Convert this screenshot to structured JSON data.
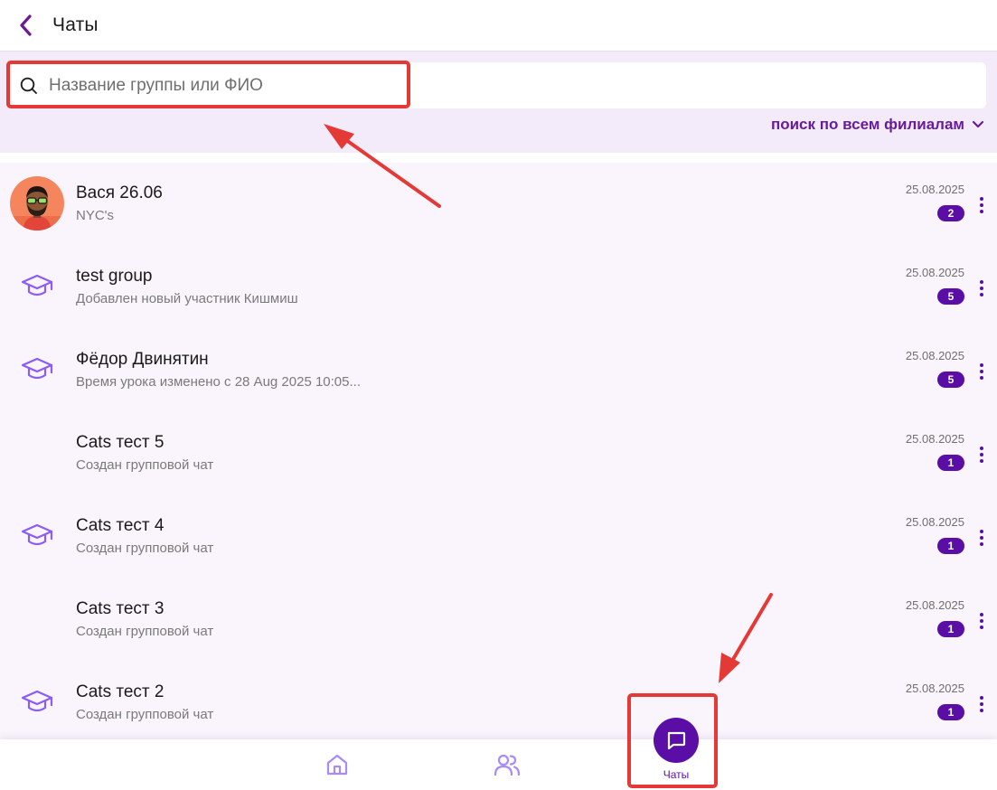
{
  "header": {
    "title": "Чаты"
  },
  "search": {
    "placeholder": "Название группы или ФИО",
    "value": ""
  },
  "branch_filter": {
    "label": "поиск по всем филиалам"
  },
  "chats": [
    {
      "name": "Вася 26.06",
      "preview": "NYC's",
      "date": "25.08.2025",
      "unread": "2",
      "icon": "user-avatar-photo"
    },
    {
      "name": "test group",
      "preview": "Добавлен новый участник Кишмиш",
      "date": "25.08.2025",
      "unread": "5",
      "icon": "graduation-cap-icon"
    },
    {
      "name": "Фёдор Двинятин",
      "preview": "Время урока изменено с 28 Aug 2025 10:05...",
      "date": "25.08.2025",
      "unread": "5",
      "icon": "graduation-cap-icon"
    },
    {
      "name": "Cats тест 5",
      "preview": "Создан групповой чат",
      "date": "25.08.2025",
      "unread": "1",
      "icon": "none"
    },
    {
      "name": "Cats тест 4",
      "preview": "Создан групповой чат",
      "date": "25.08.2025",
      "unread": "1",
      "icon": "graduation-cap-icon"
    },
    {
      "name": "Cats тест 3",
      "preview": "Создан групповой чат",
      "date": "25.08.2025",
      "unread": "1",
      "icon": "none"
    },
    {
      "name": "Cats тест 2",
      "preview": "Создан групповой чат",
      "date": "25.08.2025",
      "unread": "1",
      "icon": "graduation-cap-icon"
    }
  ],
  "bottom_nav": {
    "items": [
      {
        "id": "home",
        "icon": "home-icon",
        "label": ""
      },
      {
        "id": "people",
        "icon": "users-icon",
        "label": ""
      },
      {
        "id": "chats",
        "icon": "chat-bubble-icon",
        "label": "Чаты",
        "active": true
      }
    ]
  },
  "colors": {
    "accent": "#5b0ea6",
    "accent_light": "#8b5cf6",
    "panel_bg": "#f3ebfa",
    "list_bg": "#faf4fc",
    "annotation": "#e53935"
  }
}
